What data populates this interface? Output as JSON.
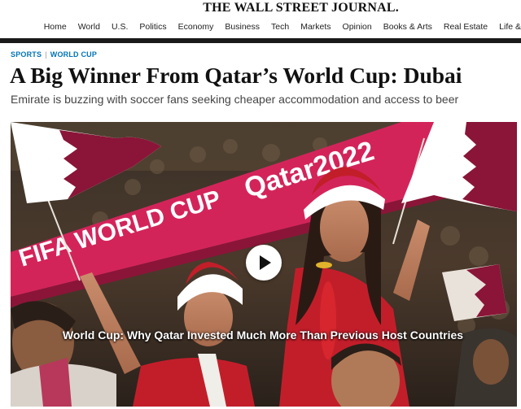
{
  "header": {
    "logo": "THE WALL STREET JOURNAL.",
    "nav": [
      "Home",
      "World",
      "U.S.",
      "Politics",
      "Economy",
      "Business",
      "Tech",
      "Markets",
      "Opinion",
      "Books & Arts",
      "Real Estate",
      "Life &"
    ]
  },
  "article": {
    "breadcrumb": [
      "SPORTS",
      "WORLD CUP"
    ],
    "headline": "A Big Winner From Qatar’s World Cup: Dubai",
    "dek": "Emirate is buzzing with soccer fans seeking cheaper accommodation and access to beer"
  },
  "video": {
    "caption": "World Cup: Why Qatar Invested Much More Than Previous Host Countries",
    "banner_text": "FIFA WORLD CUP Qatar2022",
    "play_icon": "play-icon"
  },
  "colors": {
    "link_blue": "#0274b6",
    "qatar_maroon": "#8a1538",
    "banner_pink": "#d3245a"
  }
}
